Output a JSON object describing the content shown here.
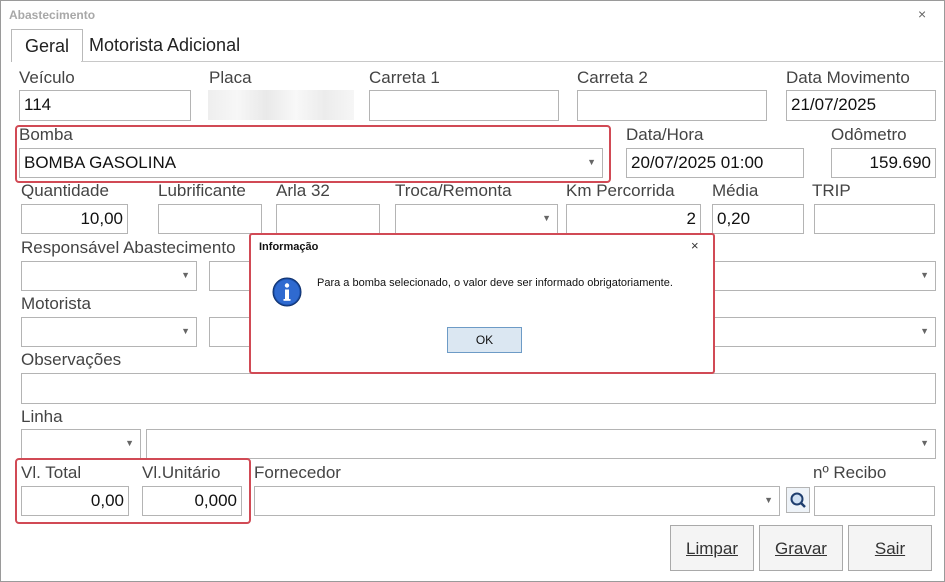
{
  "window": {
    "title": "Abastecimento",
    "close": "×"
  },
  "tabs": [
    {
      "label": "Geral"
    },
    {
      "label": "Motorista Adicional"
    }
  ],
  "fields": {
    "veiculo": {
      "label": "Veículo",
      "value": "114"
    },
    "placa": {
      "label": "Placa"
    },
    "carreta1": {
      "label": "Carreta 1",
      "value": ""
    },
    "carreta2": {
      "label": "Carreta 2",
      "value": ""
    },
    "data_movimento": {
      "label": "Data Movimento",
      "value": "21/07/2025"
    },
    "bomba": {
      "label": "Bomba",
      "value": "BOMBA GASOLINA"
    },
    "data_hora": {
      "label": "Data/Hora",
      "value": "20/07/2025 01:00"
    },
    "odometro": {
      "label": "Odômetro",
      "value": "159.690"
    },
    "quantidade": {
      "label": "Quantidade",
      "value": "10,00"
    },
    "lubrificante": {
      "label": "Lubrificante",
      "value": ""
    },
    "arla32": {
      "label": "Arla 32",
      "value": ""
    },
    "troca_remonta": {
      "label": "Troca/Remonta",
      "value": ""
    },
    "km_percorrida": {
      "label": "Km Percorrida",
      "value": "2"
    },
    "media": {
      "label": "Média",
      "value": "0,20"
    },
    "trip": {
      "label": "TRIP",
      "value": ""
    },
    "responsavel": {
      "label": "Responsável Abastecimento"
    },
    "motorista": {
      "label": "Motorista"
    },
    "observacoes": {
      "label": "Observações"
    },
    "linha": {
      "label": "Linha"
    },
    "vl_total": {
      "label": "Vl. Total",
      "value": "0,00"
    },
    "vl_unitario": {
      "label": "Vl.Unitário",
      "value": "0,000"
    },
    "fornecedor": {
      "label": "Fornecedor"
    },
    "recibo": {
      "label": "nº Recibo",
      "value": ""
    }
  },
  "buttons": {
    "limpar": "Limpar",
    "gravar": "Gravar",
    "sair": "Sair"
  },
  "dialog": {
    "title": "Informação",
    "close": "×",
    "message": "Para a bomba selecionado, o valor deve ser informado obrigatoriamente.",
    "ok": "OK",
    "icon": "info-icon"
  },
  "colors": {
    "highlight": "#d14a55",
    "dialog_ok_bg": "#dbe7f2",
    "info_blue": "#1b4fa8"
  }
}
